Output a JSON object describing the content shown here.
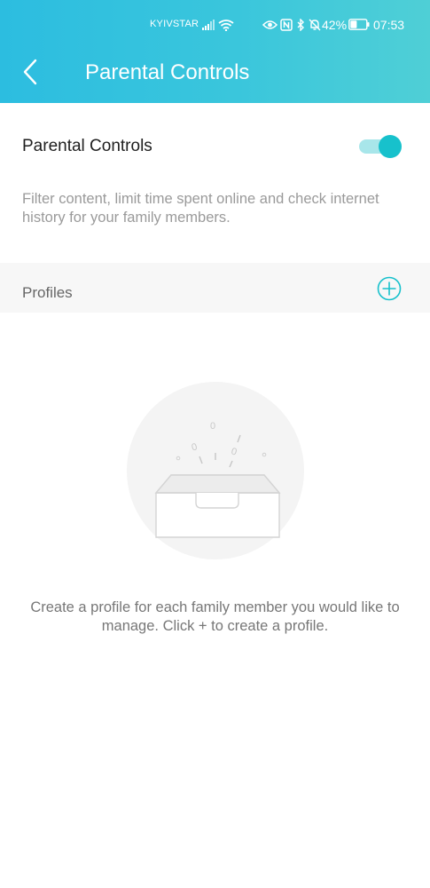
{
  "status_bar": {
    "carrier": "KYIVSTAR",
    "battery_percent": "42%",
    "time": "07:53",
    "icons": [
      "signal-icon",
      "wifi-icon",
      "eye-icon",
      "nfc-icon",
      "bluetooth-icon",
      "bell-off-icon",
      "battery-icon"
    ],
    "battery_level": 0.42
  },
  "header": {
    "title": "Parental Controls",
    "back_icon": "chevron-left-icon",
    "gradient_colors": [
      "#2cbde0",
      "#4fcfd6"
    ]
  },
  "parental_controls": {
    "label": "Parental Controls",
    "enabled": true,
    "toggle_color": "#17c1cc",
    "description": "Filter content, limit time spent online and check internet history for your family members."
  },
  "profiles": {
    "label": "Profiles",
    "add_icon": "plus-circle-icon"
  },
  "empty_state": {
    "illustration_icon": "empty-box-icon",
    "illustration_glyphs": [
      "0",
      "0",
      "0"
    ],
    "message": "Create a profile for each family member you would like to manage. Click + to create a profile."
  }
}
